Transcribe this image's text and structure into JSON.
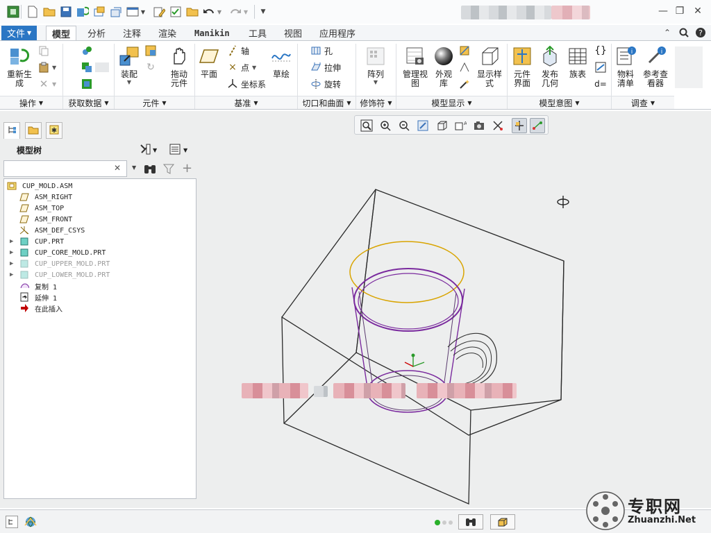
{
  "ribbon_tabs": [
    "文件",
    "模型",
    "分析",
    "注释",
    "渲染",
    "Manikin",
    "工具",
    "视图",
    "应用程序"
  ],
  "active_tab": "模型",
  "ribbon": {
    "regenerate": "重新生\n成",
    "assemble": "装配",
    "drag_components": "拖动\n元件",
    "plane": "平面",
    "axis": "轴",
    "point": "点",
    "csys": "坐标系",
    "sketch": "草绘",
    "hole": "孔",
    "extrude": "拉伸",
    "revolve": "旋转",
    "pattern": "阵列",
    "manage_views": "管理视\n图",
    "appearance": "外观\n库",
    "display_style": "显示样\n式",
    "component_interface": "元件\n界面",
    "publish_geometry": "发布\n几何",
    "family_table": "族表",
    "bom": "物料\n清单",
    "ref_viewer": "参考查\n看器"
  },
  "groups": [
    "操作",
    "获取数据",
    "元件",
    "基准",
    "切口和曲面",
    "修饰符",
    "模型显示",
    "模型意图",
    "调查"
  ],
  "sidebar": {
    "title": "模型树",
    "search_value": ""
  },
  "tree": [
    {
      "label": "CUP_MOLD.ASM",
      "icon": "assembly-icon",
      "dim": false,
      "expand": false,
      "indent": 0
    },
    {
      "label": "ASM_RIGHT",
      "icon": "datum-plane-icon",
      "dim": false,
      "expand": false,
      "indent": 1
    },
    {
      "label": "ASM_TOP",
      "icon": "datum-plane-icon",
      "dim": false,
      "expand": false,
      "indent": 1
    },
    {
      "label": "ASM_FRONT",
      "icon": "datum-plane-icon",
      "dim": false,
      "expand": false,
      "indent": 1
    },
    {
      "label": "ASM_DEF_CSYS",
      "icon": "csys-icon",
      "dim": false,
      "expand": false,
      "indent": 1
    },
    {
      "label": "CUP.PRT",
      "icon": "part-icon",
      "dim": false,
      "expand": true,
      "indent": 1
    },
    {
      "label": "CUP_CORE_MOLD.PRT",
      "icon": "part-icon",
      "dim": false,
      "expand": true,
      "indent": 1
    },
    {
      "label": "CUP_UPPER_MOLD.PRT",
      "icon": "part-icon",
      "dim": true,
      "expand": true,
      "indent": 1
    },
    {
      "label": "CUP_LOWER_MOLD.PRT",
      "icon": "part-icon",
      "dim": true,
      "expand": true,
      "indent": 1
    },
    {
      "label": "复制 1",
      "icon": "copy-feature-icon",
      "dim": false,
      "expand": false,
      "indent": 1
    },
    {
      "label": "延伸 1",
      "icon": "extend-feature-icon",
      "dim": false,
      "expand": false,
      "indent": 1
    },
    {
      "label": "在此插入",
      "icon": "insert-here-arrow-icon",
      "dim": false,
      "expand": false,
      "indent": 1
    }
  ],
  "watermark": {
    "cn": "专职网",
    "url": "Zhuanzhi.Net"
  },
  "colors": {
    "accent": "#2a76c4",
    "cup_edge": "#7a2a9e",
    "parting": "#d9a400",
    "insert_arrow": "#c00000"
  }
}
